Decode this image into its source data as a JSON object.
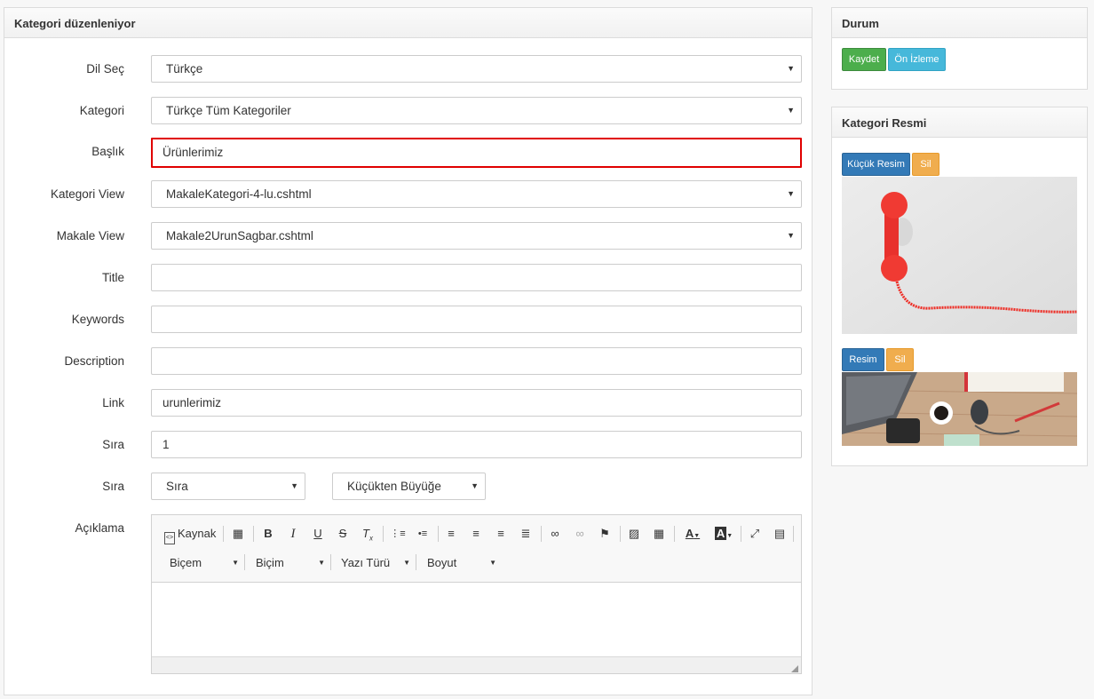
{
  "main": {
    "title": "Kategori düzenleniyor",
    "fields": {
      "language": {
        "label": "Dil Seç",
        "value": "Türkçe"
      },
      "category": {
        "label": "Kategori",
        "value": "Türkçe Tüm Kategoriler"
      },
      "heading": {
        "label": "Başlık",
        "value": "Ürünlerimiz"
      },
      "category_view": {
        "label": "Kategori View",
        "value": "MakaleKategori-4-lu.cshtml"
      },
      "article_view": {
        "label": "Makale View",
        "value": "Makale2UrunSagbar.cshtml"
      },
      "title": {
        "label": "Title",
        "value": ""
      },
      "keywords": {
        "label": "Keywords",
        "value": ""
      },
      "description": {
        "label": "Description",
        "value": ""
      },
      "link": {
        "label": "Link",
        "value": "urunlerimiz"
      },
      "order": {
        "label": "Sıra",
        "value": "1"
      },
      "sort": {
        "label": "Sıra",
        "sort_field": "Sıra",
        "sort_direction": "Küçükten Büyüğe"
      },
      "body": {
        "label": "Açıklama"
      }
    },
    "editor": {
      "source_label": "Kaynak",
      "format_combo": "Biçem",
      "style_combo": "Biçim",
      "font_combo": "Yazı Türü",
      "size_combo": "Boyut"
    }
  },
  "status": {
    "title": "Durum",
    "save_label": "Kaydet",
    "preview_label": "Ön İzleme"
  },
  "images": {
    "title": "Kategori Resmi",
    "small_image_label": "Küçük Resim",
    "small_delete_label": "Sil",
    "image_label": "Resim",
    "image_delete_label": "Sil"
  },
  "colors": {
    "save": "#4cae4c",
    "preview": "#46b8da",
    "image_button": "#337ab7",
    "delete": "#f0ad4e",
    "highlight": "#e00000"
  }
}
